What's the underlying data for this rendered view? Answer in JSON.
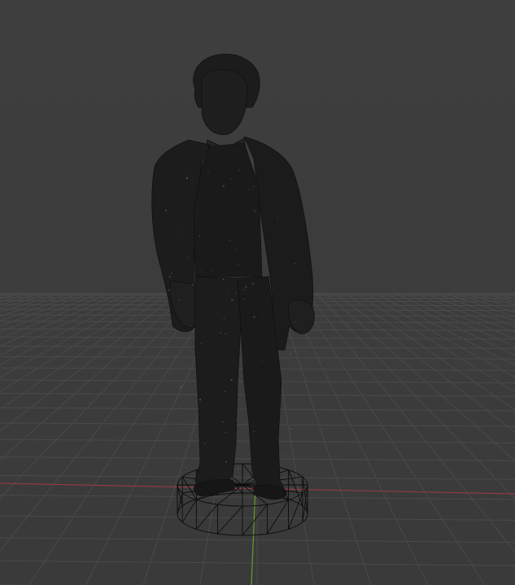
{
  "viewport": {
    "background": "#3d3d3d",
    "grid_color": "#4a4a4a",
    "x_axis_color": "#8f3b45",
    "y_axis_color": "#6a9a2a",
    "model_color": "#1b1b1b",
    "wireframe_color": "#0c0c0c"
  }
}
